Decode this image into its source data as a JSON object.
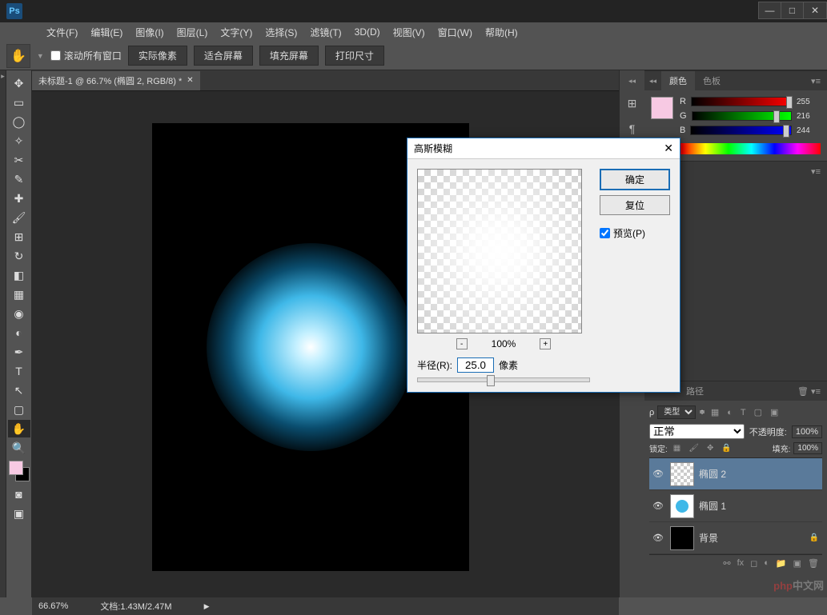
{
  "app_logo": "Ps",
  "menus": [
    "文件(F)",
    "编辑(E)",
    "图像(I)",
    "图层(L)",
    "文字(Y)",
    "选择(S)",
    "滤镜(T)",
    "3D(D)",
    "视图(V)",
    "窗口(W)",
    "帮助(H)"
  ],
  "options": {
    "scroll_all": "滚动所有窗口",
    "btn1": "实际像素",
    "btn2": "适合屏幕",
    "btn3": "填充屏幕",
    "btn4": "打印尺寸"
  },
  "doc_tab": "未标题-1 @ 66.7% (椭圆 2, RGB/8) *",
  "color_panel": {
    "tab1": "颜色",
    "tab2": "色板",
    "r_label": "R",
    "r_value": "255",
    "g_label": "G",
    "g_value": "216",
    "b_label": "B",
    "b_value": "244"
  },
  "paths_panel": {
    "paths_tab": "路径"
  },
  "layers_panel": {
    "kind_label": "类型",
    "blend_mode": "正常",
    "opacity_label": "不透明度:",
    "opacity_value": "100%",
    "lock_label": "锁定:",
    "fill_label": "填充:",
    "fill_value": "100%",
    "layers": [
      {
        "name": "椭圆 2",
        "selected": true,
        "thumb": "checker"
      },
      {
        "name": "椭圆 1",
        "selected": false,
        "thumb": "blue-dot"
      },
      {
        "name": "背景",
        "selected": false,
        "thumb": "black",
        "locked": true
      }
    ]
  },
  "status": {
    "zoom": "66.67%",
    "doc_info": "文档:1.43M/2.47M"
  },
  "dialog": {
    "title": "高斯模糊",
    "ok": "确定",
    "cancel": "复位",
    "preview": "预览(P)",
    "zoom_level": "100%",
    "radius_label": "半径(R):",
    "radius_value": "25.0",
    "radius_unit": "像素"
  },
  "watermark": {
    "php": "php",
    "cn": "中文网"
  }
}
